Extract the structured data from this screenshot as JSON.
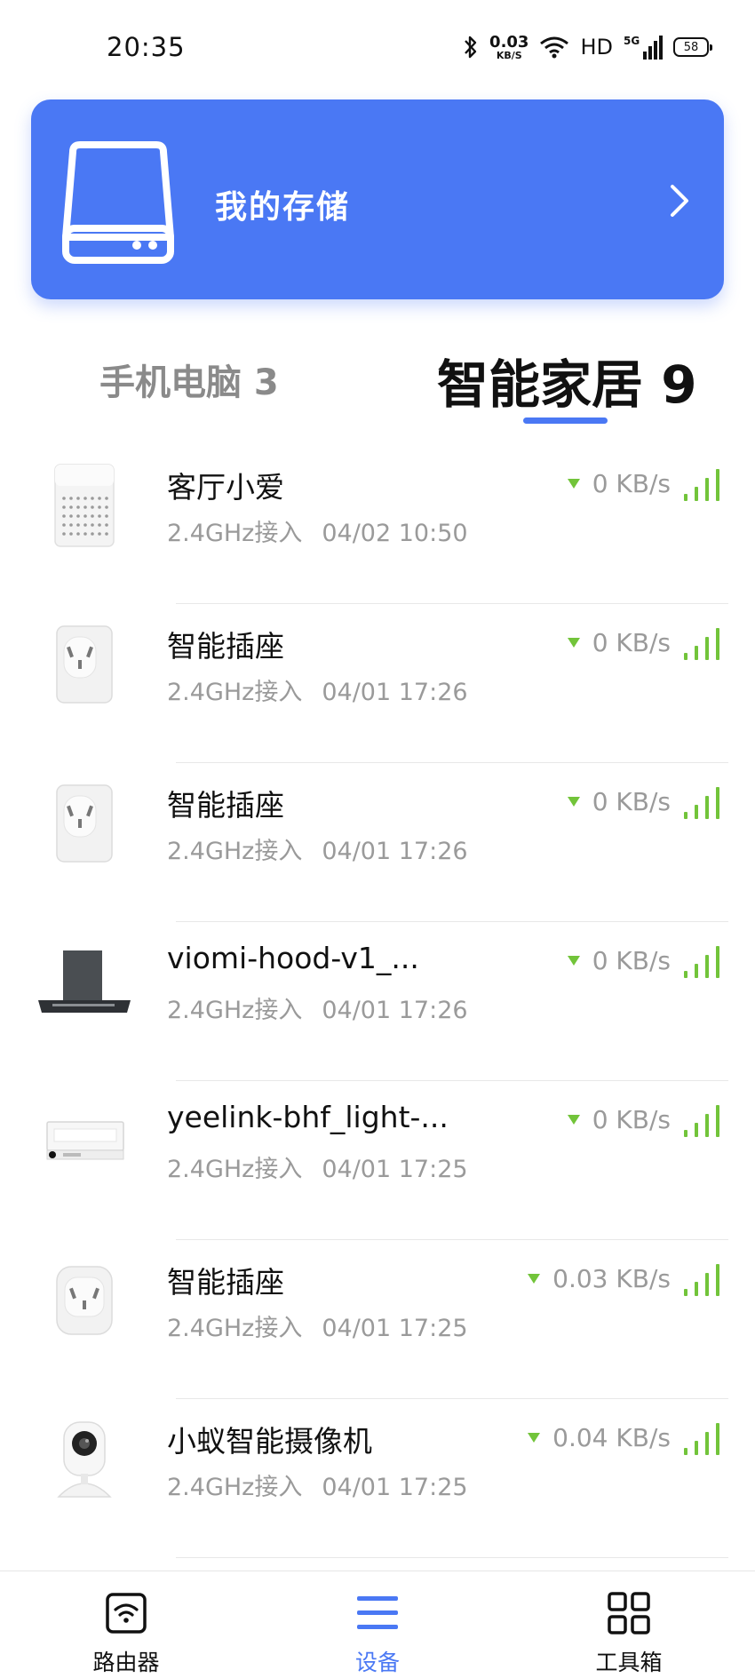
{
  "status_bar": {
    "time": "20:35",
    "speed_value": "0.03",
    "speed_unit": "KB/S",
    "hd": "HD",
    "network": "5G",
    "battery": "58"
  },
  "storage_card": {
    "title": "我的存储",
    "icon": "hard-drive-icon",
    "background_color": "#4a78f4"
  },
  "tabs": [
    {
      "label": "手机电脑 3",
      "active": false
    },
    {
      "label": "智能家居 9",
      "active": true
    }
  ],
  "devices": [
    {
      "name": "客厅小爱",
      "connection": "2.4GHz接入",
      "datetime": "04/02 10:50",
      "speed": "0 KB/s",
      "icon": "smart-speaker-icon"
    },
    {
      "name": "智能插座",
      "connection": "2.4GHz接入",
      "datetime": "04/01 17:26",
      "speed": "0 KB/s",
      "icon": "smart-plug-icon"
    },
    {
      "name": "智能插座",
      "connection": "2.4GHz接入",
      "datetime": "04/01 17:26",
      "speed": "0 KB/s",
      "icon": "smart-plug-icon"
    },
    {
      "name": "viomi-hood-v1_...",
      "connection": "2.4GHz接入",
      "datetime": "04/01 17:26",
      "speed": "0 KB/s",
      "icon": "range-hood-icon"
    },
    {
      "name": "yeelink-bhf_light-...",
      "connection": "2.4GHz接入",
      "datetime": "04/01 17:25",
      "speed": "0 KB/s",
      "icon": "bath-heater-icon"
    },
    {
      "name": "智能插座",
      "connection": "2.4GHz接入",
      "datetime": "04/01 17:25",
      "speed": "0.03 KB/s",
      "icon": "smart-plug-icon"
    },
    {
      "name": "小蚁智能摄像机",
      "connection": "2.4GHz接入",
      "datetime": "04/01 17:25",
      "speed": "0.04 KB/s",
      "icon": "smart-camera-icon"
    }
  ],
  "bottom_nav": [
    {
      "label": "路由器",
      "icon": "router-icon",
      "active": false
    },
    {
      "label": "设备",
      "icon": "menu-list-icon",
      "active": true
    },
    {
      "label": "工具箱",
      "icon": "grid-icon",
      "active": false
    }
  ],
  "colors": {
    "accent": "#4a78f4",
    "signal_green": "#72c43a",
    "secondary_text": "#9a9a9a"
  }
}
